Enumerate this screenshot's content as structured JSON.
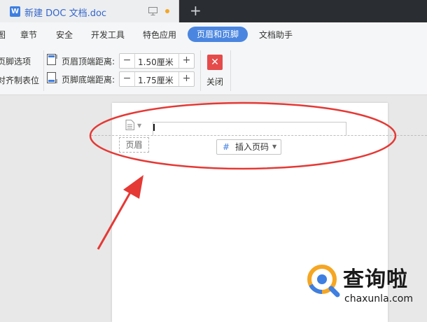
{
  "tab": {
    "title": "新建 DOC 文档.doc"
  },
  "menu": {
    "items": [
      {
        "label": "图"
      },
      {
        "label": "章节"
      },
      {
        "label": "安全"
      },
      {
        "label": "开发工具"
      },
      {
        "label": "特色应用"
      },
      {
        "label": "页眉和页脚"
      },
      {
        "label": "文档助手"
      }
    ]
  },
  "toolbar": {
    "options_label": "页脚选项",
    "align_tab_label": "对齐制表位",
    "header_distance_label": "页眉顶端距离:",
    "header_distance_value": "1.50厘米",
    "footer_distance_label": "页脚底端距离:",
    "footer_distance_value": "1.75厘米",
    "close_label": "关闭",
    "minus": "−",
    "plus": "+",
    "close_glyph": "✕"
  },
  "document": {
    "header_label": "页眉",
    "insert_page_number": "插入页码"
  },
  "annotation": {
    "color": "#e53935"
  },
  "watermark": {
    "title": "查询啦",
    "url": "chaxunla.com"
  },
  "colors": {
    "accent": "#4a86e0",
    "close": "#e54b4b",
    "tab_title": "#3366cc"
  }
}
